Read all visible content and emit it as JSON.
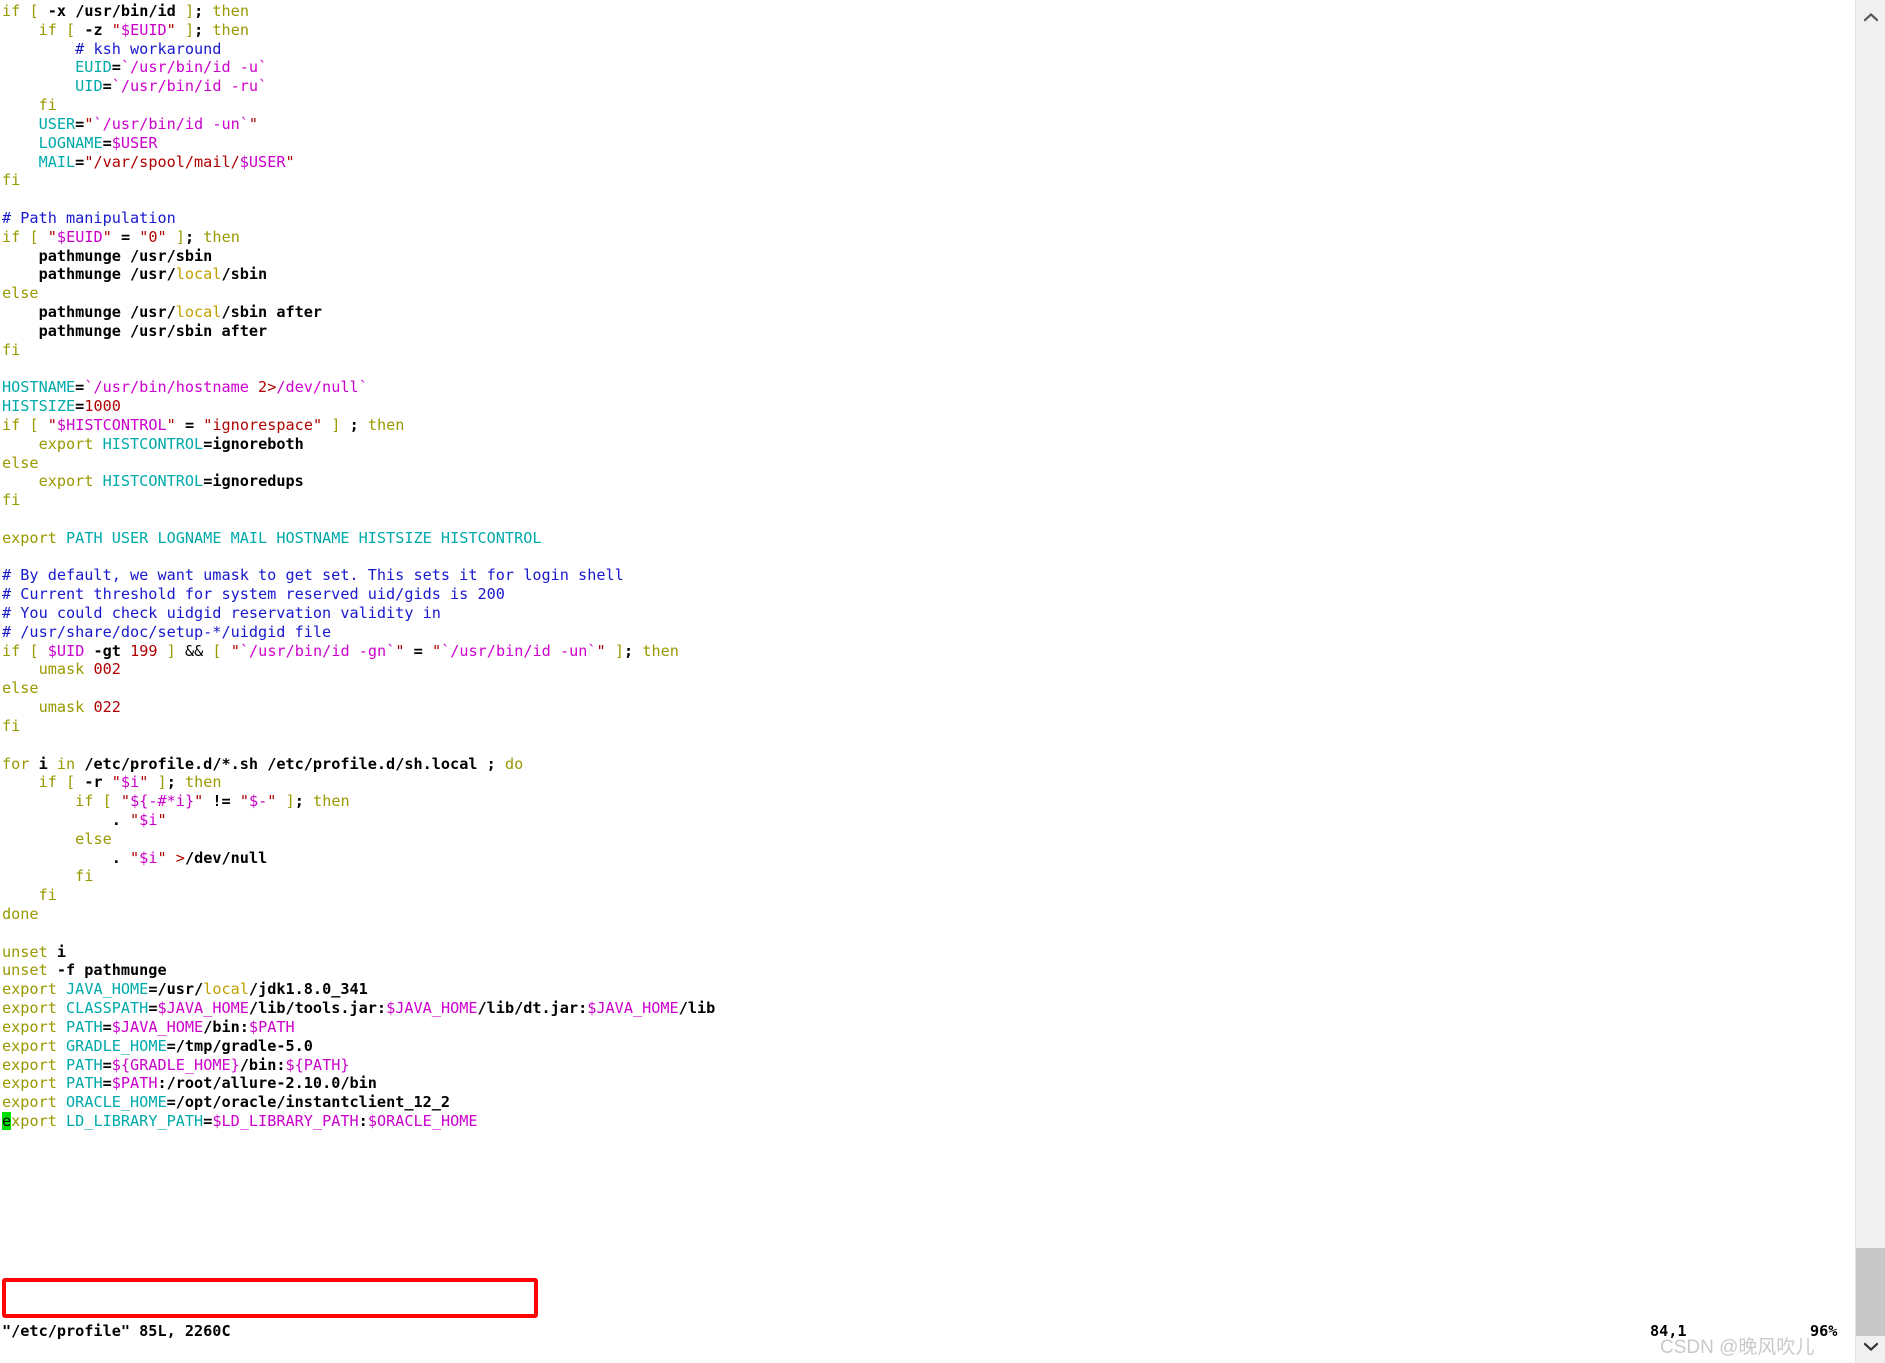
{
  "app": {
    "name": "vim",
    "filename": "/etc/profile"
  },
  "colors": {
    "background": "#ffffff",
    "statement": "#999900",
    "comment": "#1818cd",
    "identifier": "#00aaaa",
    "string": "#b00000",
    "preproc": "#cc00cc",
    "plain": "#000000",
    "cursor_bg": "#00e000",
    "annotation_box": "#fd0303",
    "watermark": "#c9c9c9",
    "scrollbar_track": "#f0f0f0",
    "scrollbar_thumb": "#c8c8c8"
  },
  "status": {
    "file_info": "\"/etc/profile\" 85L, 2260C",
    "ruler_position": "84,1",
    "ruler_percent": "96%"
  },
  "watermark": {
    "text": "CSDN @晚风吹儿"
  },
  "scrollbar": {
    "up_arrow": "chevron-up-icon",
    "down_arrow": "chevron-down-icon",
    "thumb_position": "bottom"
  },
  "annotation": {
    "type": "red-rectangle",
    "highlights_lines": [
      "export ORACLE_HOME=/opt/oracle/instantclient_12_2",
      "export LD_LIBRARY_PATH=$LD_LIBRARY_PATH:$ORACLE_HOME"
    ]
  },
  "cursor": {
    "line": 84,
    "column": 1,
    "character": "e"
  },
  "code_lines": [
    [
      {
        "t": "stmt",
        "s": "if"
      },
      {
        "t": "plain",
        "s": " "
      },
      {
        "t": "stmt",
        "s": "["
      },
      {
        "t": "plain",
        "s": " -x "
      },
      {
        "t": "plain",
        "s": "/usr/bin/id"
      },
      {
        "t": "plain",
        "s": " "
      },
      {
        "t": "stmt",
        "s": "]"
      },
      {
        "t": "plain",
        "s": "; "
      },
      {
        "t": "stmt",
        "s": "then"
      }
    ],
    [
      {
        "t": "plain",
        "s": "    "
      },
      {
        "t": "stmt",
        "s": "if"
      },
      {
        "t": "plain",
        "s": " "
      },
      {
        "t": "stmt",
        "s": "["
      },
      {
        "t": "plain",
        "s": " -z "
      },
      {
        "t": "str",
        "s": "\""
      },
      {
        "t": "pre",
        "s": "$EUID"
      },
      {
        "t": "str",
        "s": "\""
      },
      {
        "t": "plain",
        "s": " "
      },
      {
        "t": "stmt",
        "s": "]"
      },
      {
        "t": "plain",
        "s": "; "
      },
      {
        "t": "stmt",
        "s": "then"
      }
    ],
    [
      {
        "t": "plain",
        "s": "        "
      },
      {
        "t": "com",
        "s": "# ksh workaround"
      }
    ],
    [
      {
        "t": "plain",
        "s": "        "
      },
      {
        "t": "id",
        "s": "EUID"
      },
      {
        "t": "plain",
        "s": "="
      },
      {
        "t": "pre",
        "s": "`/usr/bin/id -u`"
      }
    ],
    [
      {
        "t": "plain",
        "s": "        "
      },
      {
        "t": "id",
        "s": "UID"
      },
      {
        "t": "plain",
        "s": "="
      },
      {
        "t": "pre",
        "s": "`/usr/bin/id -ru`"
      }
    ],
    [
      {
        "t": "plain",
        "s": "    "
      },
      {
        "t": "stmt",
        "s": "fi"
      }
    ],
    [
      {
        "t": "plain",
        "s": "    "
      },
      {
        "t": "id",
        "s": "USER"
      },
      {
        "t": "plain",
        "s": "="
      },
      {
        "t": "str",
        "s": "\""
      },
      {
        "t": "pre",
        "s": "`/usr/bin/id -un`"
      },
      {
        "t": "str",
        "s": "\""
      }
    ],
    [
      {
        "t": "plain",
        "s": "    "
      },
      {
        "t": "id",
        "s": "LOGNAME"
      },
      {
        "t": "plain",
        "s": "="
      },
      {
        "t": "pre",
        "s": "$USER"
      }
    ],
    [
      {
        "t": "plain",
        "s": "    "
      },
      {
        "t": "id",
        "s": "MAIL"
      },
      {
        "t": "plain",
        "s": "="
      },
      {
        "t": "str",
        "s": "\"/var/spool/mail/"
      },
      {
        "t": "pre",
        "s": "$USER"
      },
      {
        "t": "str",
        "s": "\""
      }
    ],
    [
      {
        "t": "stmt",
        "s": "fi"
      }
    ],
    [],
    [
      {
        "t": "com",
        "s": "# Path manipulation"
      }
    ],
    [
      {
        "t": "stmt",
        "s": "if"
      },
      {
        "t": "plain",
        "s": " "
      },
      {
        "t": "stmt",
        "s": "["
      },
      {
        "t": "plain",
        "s": " "
      },
      {
        "t": "str",
        "s": "\""
      },
      {
        "t": "pre",
        "s": "$EUID"
      },
      {
        "t": "str",
        "s": "\""
      },
      {
        "t": "plain",
        "s": " = "
      },
      {
        "t": "str",
        "s": "\"0\""
      },
      {
        "t": "plain",
        "s": " "
      },
      {
        "t": "stmt",
        "s": "]"
      },
      {
        "t": "plain",
        "s": "; "
      },
      {
        "t": "stmt",
        "s": "then"
      }
    ],
    [
      {
        "t": "plain",
        "s": "    pathmunge /usr/sbin"
      }
    ],
    [
      {
        "t": "plain",
        "s": "    pathmunge /usr/"
      },
      {
        "t": "spec",
        "s": "local"
      },
      {
        "t": "plain",
        "s": "/sbin"
      }
    ],
    [
      {
        "t": "stmt",
        "s": "else"
      }
    ],
    [
      {
        "t": "plain",
        "s": "    pathmunge /usr/"
      },
      {
        "t": "spec",
        "s": "local"
      },
      {
        "t": "plain",
        "s": "/sbin after"
      }
    ],
    [
      {
        "t": "plain",
        "s": "    pathmunge /usr/sbin after"
      }
    ],
    [
      {
        "t": "stmt",
        "s": "fi"
      }
    ],
    [],
    [
      {
        "t": "id",
        "s": "HOSTNAME"
      },
      {
        "t": "plain",
        "s": "="
      },
      {
        "t": "pre",
        "s": "`/usr/bin/hostname "
      },
      {
        "t": "str",
        "s": "2>"
      },
      {
        "t": "pre",
        "s": "/dev/null`"
      }
    ],
    [
      {
        "t": "id",
        "s": "HISTSIZE"
      },
      {
        "t": "plain",
        "s": "="
      },
      {
        "t": "str",
        "s": "1000"
      }
    ],
    [
      {
        "t": "stmt",
        "s": "if"
      },
      {
        "t": "plain",
        "s": " "
      },
      {
        "t": "stmt",
        "s": "["
      },
      {
        "t": "plain",
        "s": " "
      },
      {
        "t": "str",
        "s": "\""
      },
      {
        "t": "pre",
        "s": "$HISTCONTROL"
      },
      {
        "t": "str",
        "s": "\""
      },
      {
        "t": "plain",
        "s": " = "
      },
      {
        "t": "str",
        "s": "\"ignorespace\""
      },
      {
        "t": "plain",
        "s": " "
      },
      {
        "t": "stmt",
        "s": "]"
      },
      {
        "t": "plain",
        "s": " ; "
      },
      {
        "t": "stmt",
        "s": "then"
      }
    ],
    [
      {
        "t": "plain",
        "s": "    "
      },
      {
        "t": "stmt",
        "s": "export"
      },
      {
        "t": "plain",
        "s": " "
      },
      {
        "t": "id",
        "s": "HISTCONTROL"
      },
      {
        "t": "plain",
        "s": "=ignoreboth"
      }
    ],
    [
      {
        "t": "stmt",
        "s": "else"
      }
    ],
    [
      {
        "t": "plain",
        "s": "    "
      },
      {
        "t": "stmt",
        "s": "export"
      },
      {
        "t": "plain",
        "s": " "
      },
      {
        "t": "id",
        "s": "HISTCONTROL"
      },
      {
        "t": "plain",
        "s": "=ignoredups"
      }
    ],
    [
      {
        "t": "stmt",
        "s": "fi"
      }
    ],
    [],
    [
      {
        "t": "stmt",
        "s": "export"
      },
      {
        "t": "plain",
        "s": " "
      },
      {
        "t": "id",
        "s": "PATH USER LOGNAME MAIL HOSTNAME HISTSIZE HISTCONTROL"
      }
    ],
    [],
    [
      {
        "t": "com",
        "s": "# By default, we want umask to get set. This sets it for login shell"
      }
    ],
    [
      {
        "t": "com",
        "s": "# Current threshold for system reserved uid/gids is 200"
      }
    ],
    [
      {
        "t": "com",
        "s": "# You could check uidgid reservation validity in"
      }
    ],
    [
      {
        "t": "com",
        "s": "# /usr/share/doc/setup-*/uidgid file"
      }
    ],
    [
      {
        "t": "stmt",
        "s": "if"
      },
      {
        "t": "plain",
        "s": " "
      },
      {
        "t": "stmt",
        "s": "["
      },
      {
        "t": "plain",
        "s": " "
      },
      {
        "t": "pre",
        "s": "$UID"
      },
      {
        "t": "plain",
        "s": " -gt "
      },
      {
        "t": "str",
        "s": "199"
      },
      {
        "t": "plain",
        "s": " "
      },
      {
        "t": "stmt",
        "s": "]"
      },
      {
        "t": "plain",
        "s": " "
      },
      {
        "t": "op",
        "s": "&&"
      },
      {
        "t": "plain",
        "s": " "
      },
      {
        "t": "stmt",
        "s": "["
      },
      {
        "t": "plain",
        "s": " "
      },
      {
        "t": "str",
        "s": "\""
      },
      {
        "t": "pre",
        "s": "`/usr/bin/id -gn`"
      },
      {
        "t": "str",
        "s": "\""
      },
      {
        "t": "plain",
        "s": " = "
      },
      {
        "t": "str",
        "s": "\""
      },
      {
        "t": "pre",
        "s": "`/usr/bin/id -un`"
      },
      {
        "t": "str",
        "s": "\""
      },
      {
        "t": "plain",
        "s": " "
      },
      {
        "t": "stmt",
        "s": "]"
      },
      {
        "t": "plain",
        "s": "; "
      },
      {
        "t": "stmt",
        "s": "then"
      }
    ],
    [
      {
        "t": "plain",
        "s": "    "
      },
      {
        "t": "stmt",
        "s": "umask"
      },
      {
        "t": "plain",
        "s": " "
      },
      {
        "t": "str",
        "s": "002"
      }
    ],
    [
      {
        "t": "stmt",
        "s": "else"
      }
    ],
    [
      {
        "t": "plain",
        "s": "    "
      },
      {
        "t": "stmt",
        "s": "umask"
      },
      {
        "t": "plain",
        "s": " "
      },
      {
        "t": "str",
        "s": "022"
      }
    ],
    [
      {
        "t": "stmt",
        "s": "fi"
      }
    ],
    [],
    [
      {
        "t": "stmt",
        "s": "for"
      },
      {
        "t": "plain",
        "s": " i "
      },
      {
        "t": "stmt",
        "s": "in"
      },
      {
        "t": "plain",
        "s": " /etc/profile.d/*.sh /etc/profile.d/sh.local ; "
      },
      {
        "t": "stmt",
        "s": "do"
      }
    ],
    [
      {
        "t": "plain",
        "s": "    "
      },
      {
        "t": "stmt",
        "s": "if"
      },
      {
        "t": "plain",
        "s": " "
      },
      {
        "t": "stmt",
        "s": "["
      },
      {
        "t": "plain",
        "s": " -r "
      },
      {
        "t": "str",
        "s": "\""
      },
      {
        "t": "pre",
        "s": "$i"
      },
      {
        "t": "str",
        "s": "\""
      },
      {
        "t": "plain",
        "s": " "
      },
      {
        "t": "stmt",
        "s": "]"
      },
      {
        "t": "plain",
        "s": "; "
      },
      {
        "t": "stmt",
        "s": "then"
      }
    ],
    [
      {
        "t": "plain",
        "s": "        "
      },
      {
        "t": "stmt",
        "s": "if"
      },
      {
        "t": "plain",
        "s": " "
      },
      {
        "t": "stmt",
        "s": "["
      },
      {
        "t": "plain",
        "s": " "
      },
      {
        "t": "str",
        "s": "\""
      },
      {
        "t": "pre",
        "s": "${-#*i}"
      },
      {
        "t": "str",
        "s": "\""
      },
      {
        "t": "plain",
        "s": " != "
      },
      {
        "t": "str",
        "s": "\""
      },
      {
        "t": "pre",
        "s": "$-"
      },
      {
        "t": "str",
        "s": "\""
      },
      {
        "t": "plain",
        "s": " "
      },
      {
        "t": "stmt",
        "s": "]"
      },
      {
        "t": "plain",
        "s": "; "
      },
      {
        "t": "stmt",
        "s": "then"
      }
    ],
    [
      {
        "t": "plain",
        "s": "            . "
      },
      {
        "t": "str",
        "s": "\""
      },
      {
        "t": "pre",
        "s": "$i"
      },
      {
        "t": "str",
        "s": "\""
      }
    ],
    [
      {
        "t": "plain",
        "s": "        "
      },
      {
        "t": "stmt",
        "s": "else"
      }
    ],
    [
      {
        "t": "plain",
        "s": "            . "
      },
      {
        "t": "str",
        "s": "\""
      },
      {
        "t": "pre",
        "s": "$i"
      },
      {
        "t": "str",
        "s": "\""
      },
      {
        "t": "plain",
        "s": " "
      },
      {
        "t": "str",
        "s": ">"
      },
      {
        "t": "plain",
        "s": "/dev/null"
      }
    ],
    [
      {
        "t": "plain",
        "s": "        "
      },
      {
        "t": "stmt",
        "s": "fi"
      }
    ],
    [
      {
        "t": "plain",
        "s": "    "
      },
      {
        "t": "stmt",
        "s": "fi"
      }
    ],
    [
      {
        "t": "stmt",
        "s": "done"
      }
    ],
    [],
    [
      {
        "t": "stmt",
        "s": "unset"
      },
      {
        "t": "plain",
        "s": " i"
      }
    ],
    [
      {
        "t": "stmt",
        "s": "unset"
      },
      {
        "t": "plain",
        "s": " -f pathmunge"
      }
    ],
    [
      {
        "t": "stmt",
        "s": "export"
      },
      {
        "t": "plain",
        "s": " "
      },
      {
        "t": "id",
        "s": "JAVA_HOME"
      },
      {
        "t": "plain",
        "s": "=/usr/"
      },
      {
        "t": "spec",
        "s": "local"
      },
      {
        "t": "plain",
        "s": "/jdk1.8.0_341"
      }
    ],
    [
      {
        "t": "stmt",
        "s": "export"
      },
      {
        "t": "plain",
        "s": " "
      },
      {
        "t": "id",
        "s": "CLASSPATH"
      },
      {
        "t": "plain",
        "s": "="
      },
      {
        "t": "pre",
        "s": "$JAVA_HOME"
      },
      {
        "t": "plain",
        "s": "/lib/tools.jar:"
      },
      {
        "t": "pre",
        "s": "$JAVA_HOME"
      },
      {
        "t": "plain",
        "s": "/lib/dt.jar:"
      },
      {
        "t": "pre",
        "s": "$JAVA_HOME"
      },
      {
        "t": "plain",
        "s": "/lib"
      }
    ],
    [
      {
        "t": "stmt",
        "s": "export"
      },
      {
        "t": "plain",
        "s": " "
      },
      {
        "t": "id",
        "s": "PATH"
      },
      {
        "t": "plain",
        "s": "="
      },
      {
        "t": "pre",
        "s": "$JAVA_HOME"
      },
      {
        "t": "plain",
        "s": "/bin:"
      },
      {
        "t": "pre",
        "s": "$PATH"
      }
    ],
    [
      {
        "t": "stmt",
        "s": "export"
      },
      {
        "t": "plain",
        "s": " "
      },
      {
        "t": "id",
        "s": "GRADLE_HOME"
      },
      {
        "t": "plain",
        "s": "=/tmp/gradle-5.0"
      }
    ],
    [
      {
        "t": "stmt",
        "s": "export"
      },
      {
        "t": "plain",
        "s": " "
      },
      {
        "t": "id",
        "s": "PATH"
      },
      {
        "t": "plain",
        "s": "="
      },
      {
        "t": "pre",
        "s": "${GRADLE_HOME}"
      },
      {
        "t": "plain",
        "s": "/bin:"
      },
      {
        "t": "pre",
        "s": "${PATH}"
      }
    ],
    [
      {
        "t": "stmt",
        "s": "export"
      },
      {
        "t": "plain",
        "s": " "
      },
      {
        "t": "id",
        "s": "PATH"
      },
      {
        "t": "plain",
        "s": "="
      },
      {
        "t": "pre",
        "s": "$PATH"
      },
      {
        "t": "plain",
        "s": ":/root/allure-2.10.0/bin"
      }
    ],
    [
      {
        "t": "stmt",
        "s": "export"
      },
      {
        "t": "plain",
        "s": " "
      },
      {
        "t": "id",
        "s": "ORACLE_HOME"
      },
      {
        "t": "plain",
        "s": "=/opt/oracle/instantclient_12_2"
      }
    ],
    [
      {
        "t": "cursor",
        "s": "e"
      },
      {
        "t": "stmt",
        "s": "xport"
      },
      {
        "t": "plain",
        "s": " "
      },
      {
        "t": "id",
        "s": "LD_LIBRARY_PATH"
      },
      {
        "t": "plain",
        "s": "="
      },
      {
        "t": "pre",
        "s": "$LD_LIBRARY_PATH"
      },
      {
        "t": "plain",
        "s": ":"
      },
      {
        "t": "pre",
        "s": "$ORACLE_HOME"
      }
    ]
  ]
}
